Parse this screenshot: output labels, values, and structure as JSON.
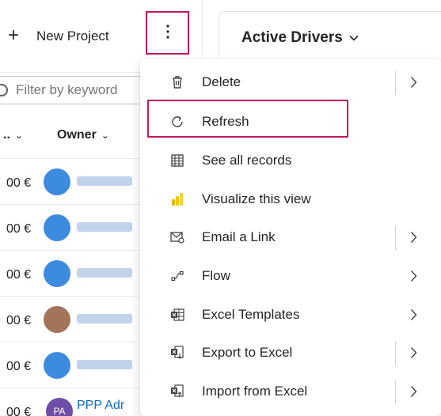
{
  "commandbar": {
    "new_project_label": "New Project"
  },
  "filter": {
    "placeholder": "Filter by keyword"
  },
  "grid": {
    "columns": [
      {
        "label": ".."
      },
      {
        "label": "Owner"
      }
    ],
    "rows": [
      {
        "amount": "00 €",
        "owner": ""
      },
      {
        "amount": "00 €",
        "owner": ""
      },
      {
        "amount": "00 €",
        "owner": ""
      },
      {
        "amount": "00 €",
        "owner": ""
      },
      {
        "amount": "00 €",
        "owner": ""
      },
      {
        "amount": "00 €",
        "owner": "PPP Adr",
        "initials": "PA"
      }
    ]
  },
  "view": {
    "title": "Active Drivers"
  },
  "menu": {
    "items": [
      {
        "label": "Delete",
        "icon": "trash-icon",
        "submenu": true,
        "split": true
      },
      {
        "label": "Refresh",
        "icon": "refresh-icon",
        "submenu": false,
        "split": false
      },
      {
        "label": "See all records",
        "icon": "table-icon",
        "submenu": false,
        "split": false
      },
      {
        "label": "Visualize this view",
        "icon": "powerbi-icon",
        "submenu": false,
        "split": false
      },
      {
        "label": "Email a Link",
        "icon": "email-link-icon",
        "submenu": true,
        "split": true
      },
      {
        "label": "Flow",
        "icon": "flow-icon",
        "submenu": true,
        "split": false
      },
      {
        "label": "Excel Templates",
        "icon": "excel-template-icon",
        "submenu": true,
        "split": false
      },
      {
        "label": "Export to Excel",
        "icon": "excel-export-icon",
        "submenu": true,
        "split": true
      },
      {
        "label": "Import from Excel",
        "icon": "excel-import-icon",
        "submenu": true,
        "split": true
      }
    ]
  },
  "colors": {
    "highlight_border": "#c4175f",
    "link": "#0f6cbd",
    "powerbi_yellow": "#f2c811"
  }
}
